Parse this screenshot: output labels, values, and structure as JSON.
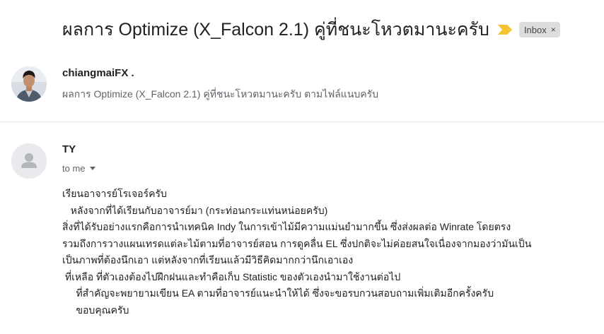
{
  "thread": {
    "subject": "ผลการ Optimize (X_Falcon 2.1) คู่ที่ชนะโหวตมานะครับ",
    "label": "Inbox",
    "label_close": "×",
    "important_color": "#f4c430"
  },
  "messages": [
    {
      "sender": "chiangmaiFX .",
      "snippet": "ผลการ Optimize (X_Falcon 2.1) คู่ที่ชนะโหวตมานะครับ ตามไฟล์แนบครับ"
    },
    {
      "sender": "TY",
      "to": "to me",
      "body": [
        "เรียนอาจารย์โรเจอร์ครับ",
        "   หลังจากที่ได้เรียนกับอาจารย์มา (กระท่อนกระแท่นหน่อยครับ)",
        "สิ่งที่ได้รับอย่างแรกคือการนำเทคนิค Indy ในการเข้าไม้มีความแม่นยำมากขึ้น ซึ่งส่งผลต่อ Winrate โดยตรง",
        "รวมถึงการวางแผนเทรดแต่ละไม้ตามที่อาจารย์สอน การดูคลื่น EL ซึ่งปกติจะไม่ค่อยสนใจเนื่องจากมองว่ามันเป็น",
        "เป็นภาพที่ต้องนึกเอา แต่หลังจากที่เรียนแล้วมีวิธีคิดมากกว่านึกเอาเอง",
        " ที่เหลือ ที่ตัวเองต้องไปฝึกฝนและทำคือเก็บ Statistic ของตัวเองนำมาใช้งานต่อไป",
        "     ที่สำคัญจะพยายามเขียน EA ตามที่อาจารย์แนะนำให้ได้ ซึ่งจะขอรบกวนสอบถามเพิ่มเติมอีกครั้งครับ",
        "     ขอบคุณครับ"
      ]
    }
  ]
}
